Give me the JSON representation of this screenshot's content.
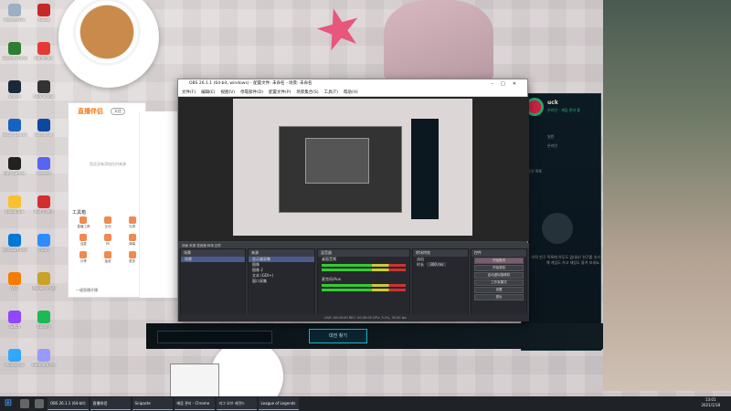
{
  "desktop_icons": [
    {
      "label": "Recycle Bin",
      "color": "#9bb0c4"
    },
    {
      "label": "Adobe",
      "color": "#c62828"
    },
    {
      "label": "Google Chrome",
      "color": "#2e7d32"
    },
    {
      "label": "Bandicam",
      "color": "#e53935"
    },
    {
      "label": "Steam",
      "color": "#1b2838"
    },
    {
      "label": "OBS Studio",
      "color": "#333333"
    },
    {
      "label": "Nexon Launcher",
      "color": "#1565c0"
    },
    {
      "label": "Battle.net",
      "color": "#0d47a1"
    },
    {
      "label": "Epic Games",
      "color": "#212121"
    },
    {
      "label": "Discord",
      "color": "#5865f2"
    },
    {
      "label": "KakaoTalk",
      "color": "#fbc02d"
    },
    {
      "label": "Riot Client",
      "color": "#d32f2f"
    },
    {
      "label": "Microsoft Edge",
      "color": "#0078d4"
    },
    {
      "label": "Zoom",
      "color": "#2d8cff"
    },
    {
      "label": "VLC",
      "color": "#f57c00"
    },
    {
      "label": "League of Legends",
      "color": "#c9a227"
    },
    {
      "label": "Twitch",
      "color": "#9146ff"
    },
    {
      "label": "Spotify",
      "color": "#1db954"
    },
    {
      "label": "Photoshop",
      "color": "#31a8ff"
    },
    {
      "label": "Premiere Pro",
      "color": "#9999ff"
    }
  ],
  "live_app": {
    "logo": "直播伴侣",
    "badge": "天信",
    "hint": "您还没有添加任何来源",
    "tools_label": "工具箱",
    "tools": [
      "直播工具",
      "互动",
      "礼物",
      "连麦",
      "PK",
      "弹幕",
      "分享",
      "抽奖",
      "更多"
    ],
    "footer": "一键直播开播"
  },
  "obs": {
    "title": "OBS 26.1.1 (64-bit, windows) - 配置文件: 未命名 - 场景: 未命名",
    "menu": [
      "文件(F)",
      "编辑(E)",
      "视图(V)",
      "停靠部件(D)",
      "配置文件(P)",
      "场景集合(S)",
      "工具(T)",
      "帮助(H)"
    ],
    "docks_tabs": "场景  来源  混音器  转场  控件",
    "scenes_header": "场景",
    "scenes": [
      "场景"
    ],
    "sources_header": "来源",
    "sources": [
      "显示器采集",
      "图像",
      "图像 2",
      "文本 (GDI+)",
      "窗口采集"
    ],
    "mixer_header": "混音器",
    "mixer": [
      "桌面音频",
      "麦克风/Aux"
    ],
    "transition_header": "转场特效",
    "transition_value": "淡出",
    "duration_label": "时长",
    "duration_value": "300 ms",
    "controls_header": "控件",
    "controls": [
      "开始推流",
      "开始录制",
      "启动虚拟摄像机",
      "工作室模式",
      "设置",
      "退出"
    ],
    "status": "LIVE: 00:00:00   REC: 00:00:00   CPU: 3.2%, 30.00 fps"
  },
  "lol": {
    "name": "uck",
    "status": "온라인 - 게임 준비 중",
    "section": "친구 목록",
    "rows": [
      "일반",
      "온라인"
    ],
    "empty_text": "아직 친구 목록에 아무도 없네요! 친구를 추가해 게임도 하고 채팅도 즐겨 보세요.",
    "footer_label": "채팅"
  },
  "game_bar": {
    "button_label": "대전 찾기"
  },
  "taskbar": {
    "tasks": [
      "OBS 26.1.1 (64-bit)",
      "直播伴侣",
      "Snipaste",
      "배움 관리 - Chrome",
      "리그 오브 레전드",
      "League of Legends"
    ],
    "time": "13:01",
    "date": "2021/1/18"
  }
}
